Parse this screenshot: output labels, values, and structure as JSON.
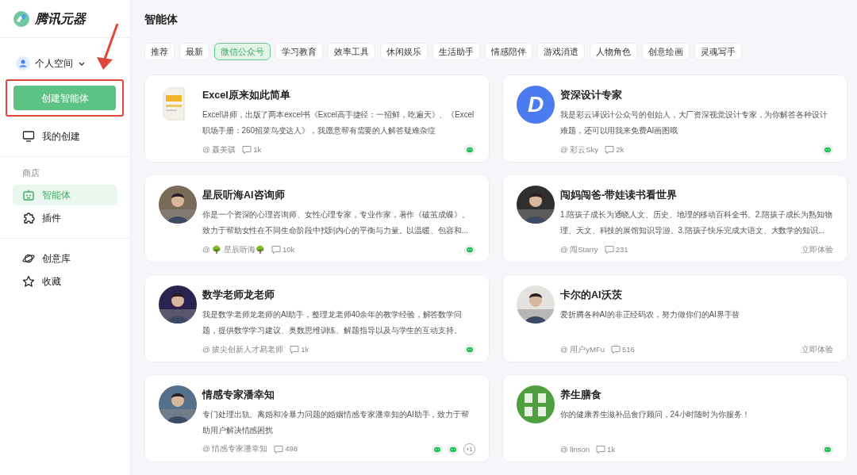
{
  "app": {
    "name": "腾讯元器"
  },
  "sidebar": {
    "space": "个人空间",
    "create_button": {
      "label": "创建智能体",
      "highlighted": true
    },
    "my_item": {
      "label": "我的创建",
      "selected": false
    },
    "store_label": "商店",
    "store_items": [
      {
        "label": "智能体",
        "selected": true
      },
      {
        "label": "插件",
        "selected": false
      }
    ],
    "bottom_items": [
      {
        "label": "创意库",
        "selected": false
      },
      {
        "label": "收藏",
        "selected": false
      }
    ]
  },
  "page": {
    "title": "智能体"
  },
  "tabs": [
    {
      "label": "推荐",
      "selected": false
    },
    {
      "label": "最新",
      "selected": false
    },
    {
      "label": "微信公众号",
      "selected": true
    },
    {
      "label": "学习教育",
      "selected": false
    },
    {
      "label": "效率工具",
      "selected": false
    },
    {
      "label": "休闲娱乐",
      "selected": false
    },
    {
      "label": "生活助手",
      "selected": false
    },
    {
      "label": "情感陪伴",
      "selected": false
    },
    {
      "label": "游戏消遣",
      "selected": false
    },
    {
      "label": "人物角色",
      "selected": false
    },
    {
      "label": "创意绘画",
      "selected": false
    },
    {
      "label": "灵魂写手",
      "selected": false
    }
  ],
  "cards": [
    {
      "title": "Excel原来如此简单",
      "avatar": {
        "kind": "book"
      },
      "description": "Excel讲师，出版了两本excel书《Excel高手捷径：一招鲜，吃遍天》、《Excel职场手册：260招菜鸟变达人》，我愿意帮有需要的人解答疑难杂症",
      "author": "@ 聂美骐",
      "comments": "1k",
      "channels": [
        {
          "kind": "wechat"
        }
      ]
    },
    {
      "title": "资深设计专家",
      "avatar": {
        "kind": "letter",
        "letter": "D"
      },
      "description": "我是彩云译设计公众号的创始人，大厂资深视觉设计专家，为你解答各种设计难题，还可以用我来免费AI画图哦",
      "author": "@ 彩云Sky",
      "comments": "2k",
      "channels": [
        {
          "kind": "wechat"
        }
      ]
    },
    {
      "title": "星辰听海AI咨询师",
      "avatar": {
        "kind": "person"
      },
      "description": "你是一个资深的心理咨询师、女性心理专家，专业作家，著作《破茧成蝶》。致力于帮助女性在不同生命阶段中找到内心的平衡与力量。以温暖、包容和...",
      "author": "@ 🌳 星辰听海🌳",
      "comments": "10k",
      "channels": [
        {
          "kind": "wechat"
        }
      ]
    },
    {
      "title": "闯妈闯爸-带娃读书看世界",
      "avatar": {
        "kind": "person"
      },
      "description": "1.陪孩子成长为通晓人文、历史、地理的移动百科全书。2.陪孩子成长为熟知物理、天文、科技的展馆知识导游。3.陪孩子快乐完成大语文、大数学的知识...",
      "author": "@ 闯Starry",
      "comments": "231",
      "action": "立即体验"
    },
    {
      "title": "数学老师龙老师",
      "avatar": {
        "kind": "person"
      },
      "description": "我是数学老师龙老师的AI助手，整理龙老师40余年的教学经验，解答数学问题，提供数学学习建议、奥数思维训练、解题指导以及与学生的互动支持。",
      "author": "@ 拔尖创新人才易老师",
      "comments": "1k",
      "channels": [
        {
          "kind": "wechat"
        }
      ]
    },
    {
      "title": "卡尔的AI沃茨",
      "avatar": {
        "kind": "person"
      },
      "description": "爱折腾各种AI的非正经码农，努力做你们的AI界手替",
      "author": "@ 用户yMFu",
      "comments": "516",
      "action": "立即体验"
    },
    {
      "title": "情感专家潘幸知",
      "avatar": {
        "kind": "person"
      },
      "description": "专门处理出轨、离婚和冷暴力问题的婚姻情感专家潘幸知的AI助手，致力于帮助用户解决情感困扰",
      "author": "@ 情感专家潘幸知",
      "comments": "498",
      "channels": [
        {
          "kind": "wechat"
        },
        {
          "kind": "wechat"
        }
      ],
      "more": "+1"
    },
    {
      "title": "养生膳食",
      "avatar": {
        "kind": "badge"
      },
      "description": "你的健康养生滋补品食疗顾问，24小时随时为你服务！",
      "author": "@ linson",
      "comments": "1k",
      "channels": [
        {
          "kind": "wechat"
        }
      ]
    }
  ]
}
